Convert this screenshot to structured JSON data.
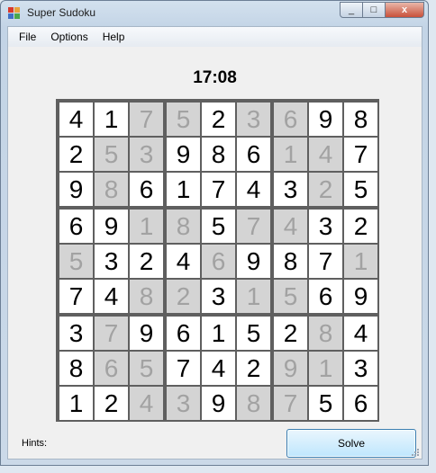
{
  "window": {
    "title": "Super Sudoku",
    "close_glyph": "x",
    "max_glyph": "□",
    "min_glyph": "_"
  },
  "menu": {
    "items": [
      "File",
      "Options",
      "Help"
    ]
  },
  "timer": "17:08",
  "board": [
    [
      {
        "v": "4",
        "hint": false
      },
      {
        "v": "1",
        "hint": false
      },
      {
        "v": "7",
        "hint": true
      },
      {
        "v": "5",
        "hint": true
      },
      {
        "v": "2",
        "hint": false
      },
      {
        "v": "3",
        "hint": true
      },
      {
        "v": "6",
        "hint": true
      },
      {
        "v": "9",
        "hint": false
      },
      {
        "v": "8",
        "hint": false
      }
    ],
    [
      {
        "v": "2",
        "hint": false
      },
      {
        "v": "5",
        "hint": true
      },
      {
        "v": "3",
        "hint": true
      },
      {
        "v": "9",
        "hint": false
      },
      {
        "v": "8",
        "hint": false
      },
      {
        "v": "6",
        "hint": false
      },
      {
        "v": "1",
        "hint": true
      },
      {
        "v": "4",
        "hint": true
      },
      {
        "v": "7",
        "hint": false
      }
    ],
    [
      {
        "v": "9",
        "hint": false
      },
      {
        "v": "8",
        "hint": true
      },
      {
        "v": "6",
        "hint": false
      },
      {
        "v": "1",
        "hint": false
      },
      {
        "v": "7",
        "hint": false
      },
      {
        "v": "4",
        "hint": false
      },
      {
        "v": "3",
        "hint": false
      },
      {
        "v": "2",
        "hint": true
      },
      {
        "v": "5",
        "hint": false
      }
    ],
    [
      {
        "v": "6",
        "hint": false
      },
      {
        "v": "9",
        "hint": false
      },
      {
        "v": "1",
        "hint": true
      },
      {
        "v": "8",
        "hint": true
      },
      {
        "v": "5",
        "hint": false
      },
      {
        "v": "7",
        "hint": true
      },
      {
        "v": "4",
        "hint": true
      },
      {
        "v": "3",
        "hint": false
      },
      {
        "v": "2",
        "hint": false
      }
    ],
    [
      {
        "v": "5",
        "hint": true
      },
      {
        "v": "3",
        "hint": false
      },
      {
        "v": "2",
        "hint": false
      },
      {
        "v": "4",
        "hint": false
      },
      {
        "v": "6",
        "hint": true
      },
      {
        "v": "9",
        "hint": false
      },
      {
        "v": "8",
        "hint": false
      },
      {
        "v": "7",
        "hint": false
      },
      {
        "v": "1",
        "hint": true
      }
    ],
    [
      {
        "v": "7",
        "hint": false
      },
      {
        "v": "4",
        "hint": false
      },
      {
        "v": "8",
        "hint": true
      },
      {
        "v": "2",
        "hint": true
      },
      {
        "v": "3",
        "hint": false
      },
      {
        "v": "1",
        "hint": true
      },
      {
        "v": "5",
        "hint": true
      },
      {
        "v": "6",
        "hint": false
      },
      {
        "v": "9",
        "hint": false
      }
    ],
    [
      {
        "v": "3",
        "hint": false
      },
      {
        "v": "7",
        "hint": true
      },
      {
        "v": "9",
        "hint": false
      },
      {
        "v": "6",
        "hint": false
      },
      {
        "v": "1",
        "hint": false
      },
      {
        "v": "5",
        "hint": false
      },
      {
        "v": "2",
        "hint": false
      },
      {
        "v": "8",
        "hint": true
      },
      {
        "v": "4",
        "hint": false
      }
    ],
    [
      {
        "v": "8",
        "hint": false
      },
      {
        "v": "6",
        "hint": true
      },
      {
        "v": "5",
        "hint": true
      },
      {
        "v": "7",
        "hint": false
      },
      {
        "v": "4",
        "hint": false
      },
      {
        "v": "2",
        "hint": false
      },
      {
        "v": "9",
        "hint": true
      },
      {
        "v": "1",
        "hint": true
      },
      {
        "v": "3",
        "hint": false
      }
    ],
    [
      {
        "v": "1",
        "hint": false
      },
      {
        "v": "2",
        "hint": false
      },
      {
        "v": "4",
        "hint": true
      },
      {
        "v": "3",
        "hint": true
      },
      {
        "v": "9",
        "hint": false
      },
      {
        "v": "8",
        "hint": true
      },
      {
        "v": "7",
        "hint": true
      },
      {
        "v": "5",
        "hint": false
      },
      {
        "v": "6",
        "hint": false
      }
    ]
  ],
  "footer": {
    "hints_label": "Hints:",
    "solve_label": "Solve"
  },
  "colors": {
    "given_bg": "#ffffff",
    "hint_bg": "#d4d4d4",
    "hint_text": "#a2a2a2",
    "grid_line": "#5f5f5f"
  }
}
